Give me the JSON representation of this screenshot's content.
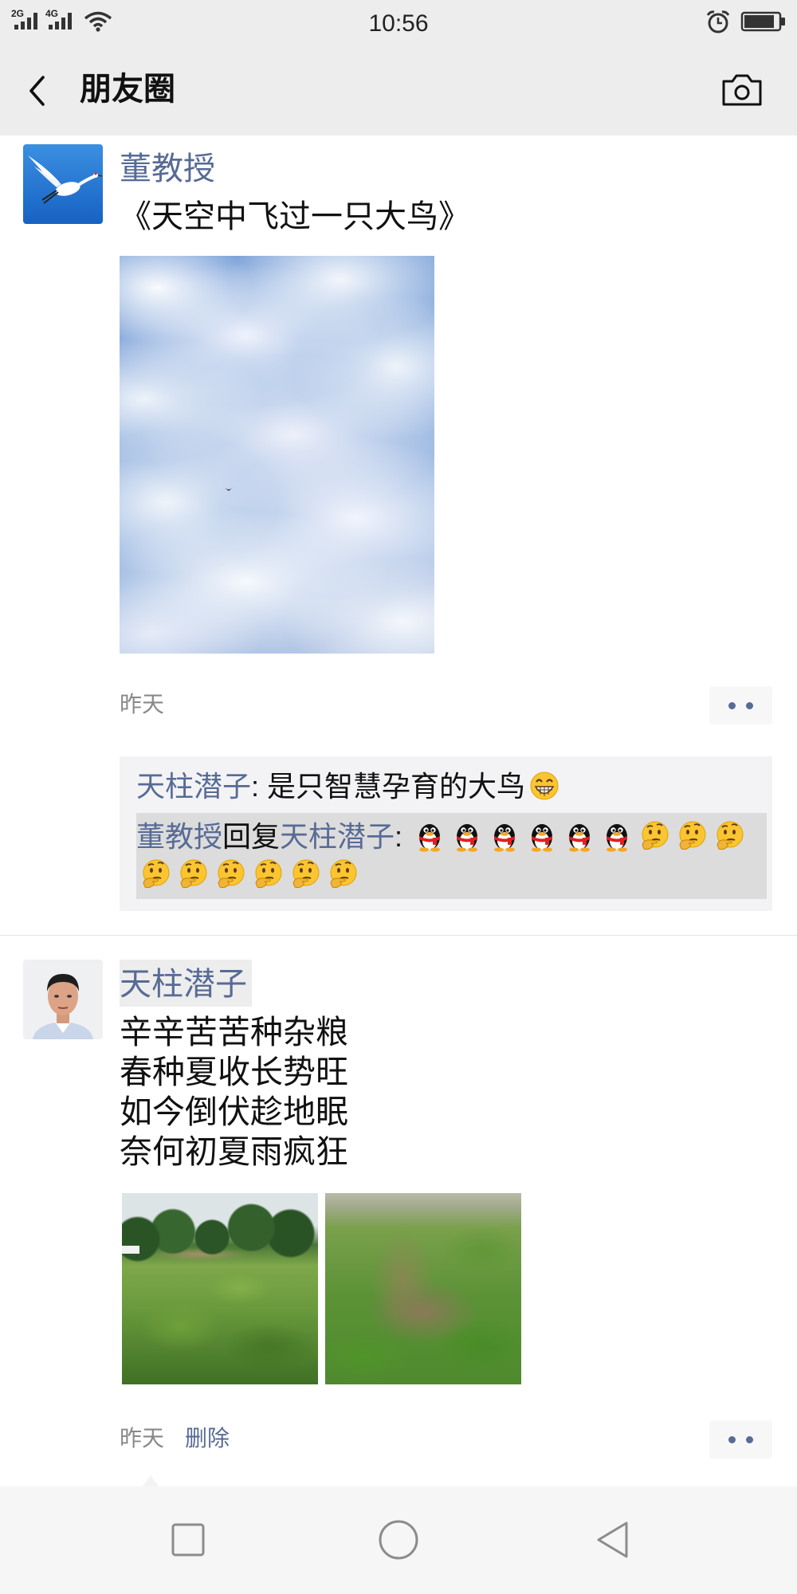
{
  "status_bar": {
    "network_a": "2G",
    "network_b": "4G",
    "time": "10:56",
    "icons": [
      "signal-icon",
      "wifi-icon",
      "alarm-icon",
      "battery-icon"
    ]
  },
  "nav": {
    "title": "朋友圈",
    "icons": [
      "back-chevron-icon",
      "camera-icon"
    ]
  },
  "colors": {
    "link": "#576b95",
    "header_bg": "#ededed",
    "comment_bg": "#f3f3f5",
    "comment_highlight": "#dcdcdc"
  },
  "posts": [
    {
      "author": "董教授",
      "text": "《天空中飞过一只大鸟》",
      "time": "昨天",
      "comments": [
        {
          "author": "天柱潜子",
          "separator": ": ",
          "text": "是只智慧孕育的大鸟",
          "emojis": [
            "grinning-face"
          ]
        },
        {
          "author": "董教授",
          "reply_word": "回复",
          "reply_to": "天柱潜子",
          "separator": ": ",
          "emojis": [
            "penguin",
            "penguin",
            "penguin",
            "penguin",
            "penguin",
            "penguin",
            "thinking-face",
            "thinking-face",
            "thinking-face",
            "thinking-face",
            "thinking-face",
            "thinking-face",
            "thinking-face",
            "thinking-face",
            "thinking-face"
          ]
        }
      ]
    },
    {
      "author": "天柱潜子",
      "lines": [
        "辛辛苦苦种杂粮",
        "春种夏收长势旺",
        "如今倒伏趁地眠",
        "奈何初夏雨疯狂"
      ],
      "time": "昨天",
      "delete_label": "删除"
    }
  ],
  "bottom_nav": {
    "icons": [
      "recent-apps-icon",
      "home-icon",
      "back-icon"
    ]
  }
}
